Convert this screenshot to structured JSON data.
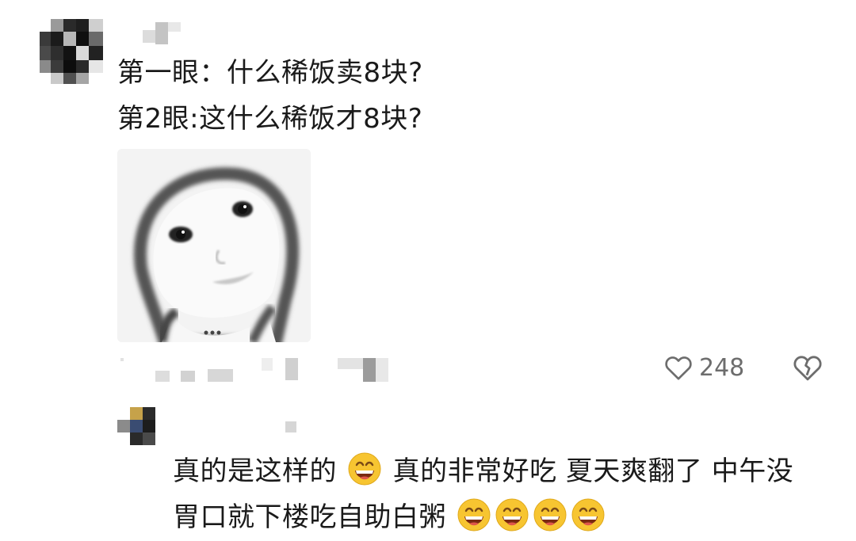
{
  "comment1": {
    "line1": "第一眼：什么稀饭卖8块?",
    "line2": "第2眼:这什么稀饭才8块?",
    "likes": "248",
    "icons": {
      "like": "heart-outline-icon",
      "dislike": "broken-heart-icon"
    }
  },
  "reply": {
    "line1_part1": "真的是这样的",
    "line1_part2": "真的非常好吃 夏天爽翻了 中午没",
    "line2": "胃口就下楼吃自助白粥",
    "emoji": "grinning-face-emoji"
  }
}
